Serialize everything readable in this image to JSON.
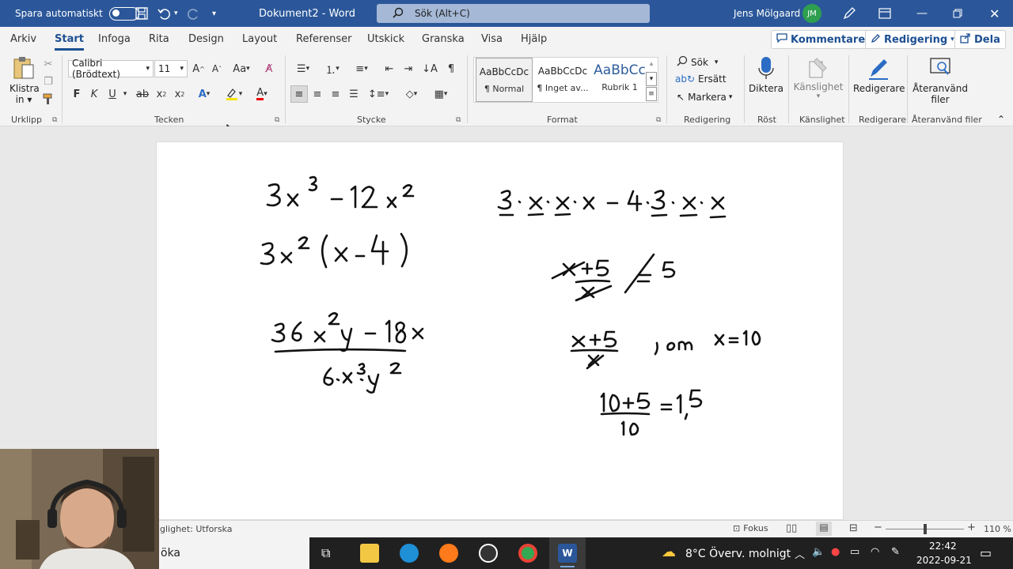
{
  "titlebar": {
    "autosave_label": "Spara automatiskt",
    "doc_title": "Dokument2  -  Word",
    "search_placeholder": "Sök (Alt+C)",
    "user_name": "Jens Mölgaard",
    "user_initials": "JM"
  },
  "tabs": [
    "Arkiv",
    "Start",
    "Infoga",
    "Rita",
    "Design",
    "Layout",
    "Referenser",
    "Utskick",
    "Granska",
    "Visa",
    "Hjälp"
  ],
  "actions": {
    "comments": "Kommentarer",
    "editing": "Redigering",
    "share": "Dela"
  },
  "ribbon": {
    "clipboard": {
      "paste": "Klistra",
      "paste_sub": "in",
      "group": "Urklipp"
    },
    "font": {
      "name": "Calibri (Brödtext)",
      "size": "11",
      "group": "Tecken",
      "bold": "F",
      "italic": "K",
      "underline": "U",
      "strike": "ab"
    },
    "paragraph": {
      "group": "Stycke"
    },
    "styles": {
      "group": "Format",
      "items": [
        {
          "preview": "AaBbCcDc",
          "name": "¶ Normal"
        },
        {
          "preview": "AaBbCcDc",
          "name": "¶ Inget av..."
        },
        {
          "preview": "AaBbCc",
          "name": "Rubrik 1"
        }
      ]
    },
    "editing": {
      "find": "Sök",
      "replace": "Ersätt",
      "select": "Markera",
      "group": "Redigering"
    },
    "voice": {
      "dictate": "Diktera",
      "group": "Röst"
    },
    "sensitivity": {
      "label": "Känslighet",
      "group": "Känslighet"
    },
    "editor": {
      "label": "Redigerare",
      "group": "Redigerare"
    },
    "reuse": {
      "label1": "Återanvänd",
      "label2": "filer",
      "group": "Återanvänd filer"
    }
  },
  "statusbar": {
    "accessibility": "glighet: Utforska",
    "focus": "Fokus",
    "zoom": "110 %"
  },
  "taskbar": {
    "search_text": "öka",
    "weather": "8°C  Överv. molnigt",
    "time": "22:42",
    "date": "2022-09-21"
  },
  "colors": {
    "titlebar": "#2b579a",
    "accent": "#1d4f91",
    "avatar": "#2e9e4f"
  }
}
